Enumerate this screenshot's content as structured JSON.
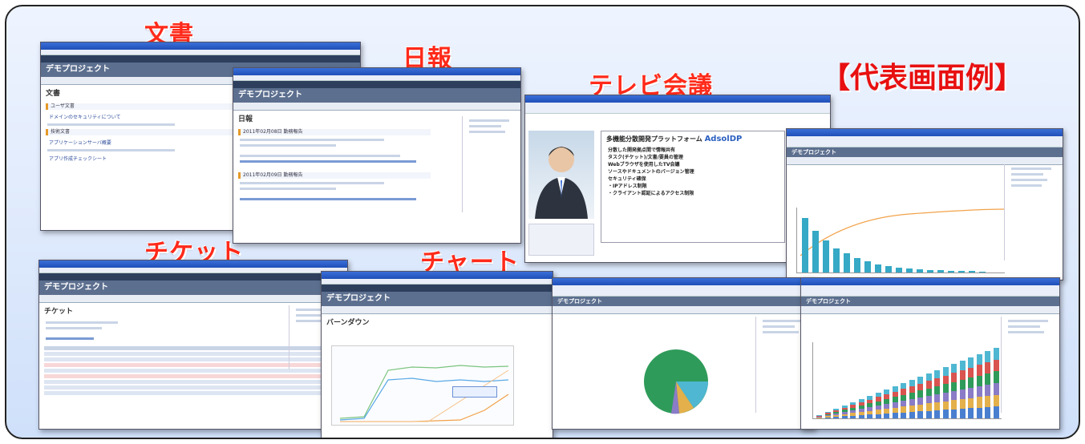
{
  "title": "【代表画面例】",
  "labels": {
    "doc": "文書",
    "daily": "日報",
    "tv": "テレビ会議",
    "ticket": "チケット",
    "chart": "チャート"
  },
  "project_name": "デモプロジェクト",
  "doc_window": {
    "page_heading": "文書",
    "section_user": "ユーザ文書",
    "section_tech": "技術文書",
    "items": [
      "ドメインのセキュリティについて",
      "アプリケーションサーバ概要",
      "アプリ作成チェックシート"
    ]
  },
  "daily_window": {
    "page_heading": "日報",
    "entries": [
      "2011年02月08日 勤務報告",
      "2011年02月09日 勤務報告"
    ]
  },
  "tv_window": {
    "banner": "多機能分散開発プラットフォーム",
    "brand": "AdsolDP",
    "features": [
      "分散した開発拠点間で情報共有",
      "タスク(チケット)/文書/要員の管理",
      "Webブラウザを使用したTV会議",
      "ソースやドキュメントのバージョン管理",
      "セキュリティ確保",
      "・IPアドレス制限",
      "・クライアント認証によるアクセス制限"
    ]
  },
  "ticket_window": {
    "page_heading": "チケット"
  },
  "chart_window": {
    "page_heading": "バーンダウン"
  },
  "colors": {
    "accent": "#ff2a1a",
    "window_title": "#1f4fb8",
    "project_bar": "#5c6f8f"
  }
}
